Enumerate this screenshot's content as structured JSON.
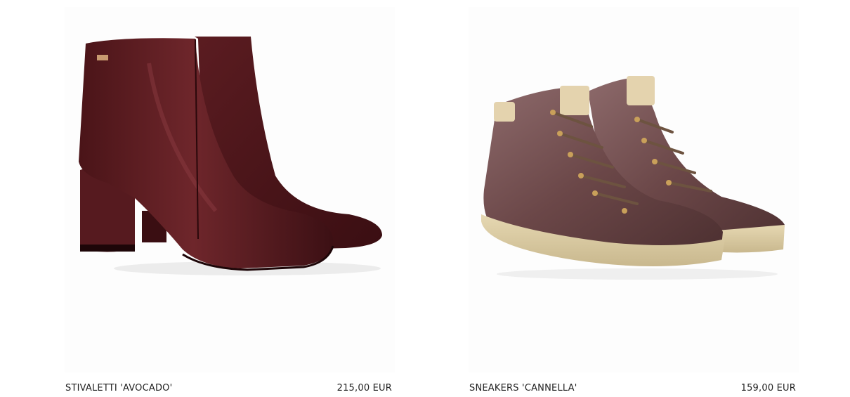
{
  "products": [
    {
      "name": "STIVALETTI 'AVOCADO'",
      "price": "215,00 EUR",
      "image": "burgundy-leather-ankle-boots",
      "color": "#5a1e22"
    },
    {
      "name": "SNEAKERS 'CANNELLA'",
      "price": "159,00 EUR",
      "image": "mauve-velvet-high-top-sneakers",
      "color": "#6b4748"
    }
  ]
}
